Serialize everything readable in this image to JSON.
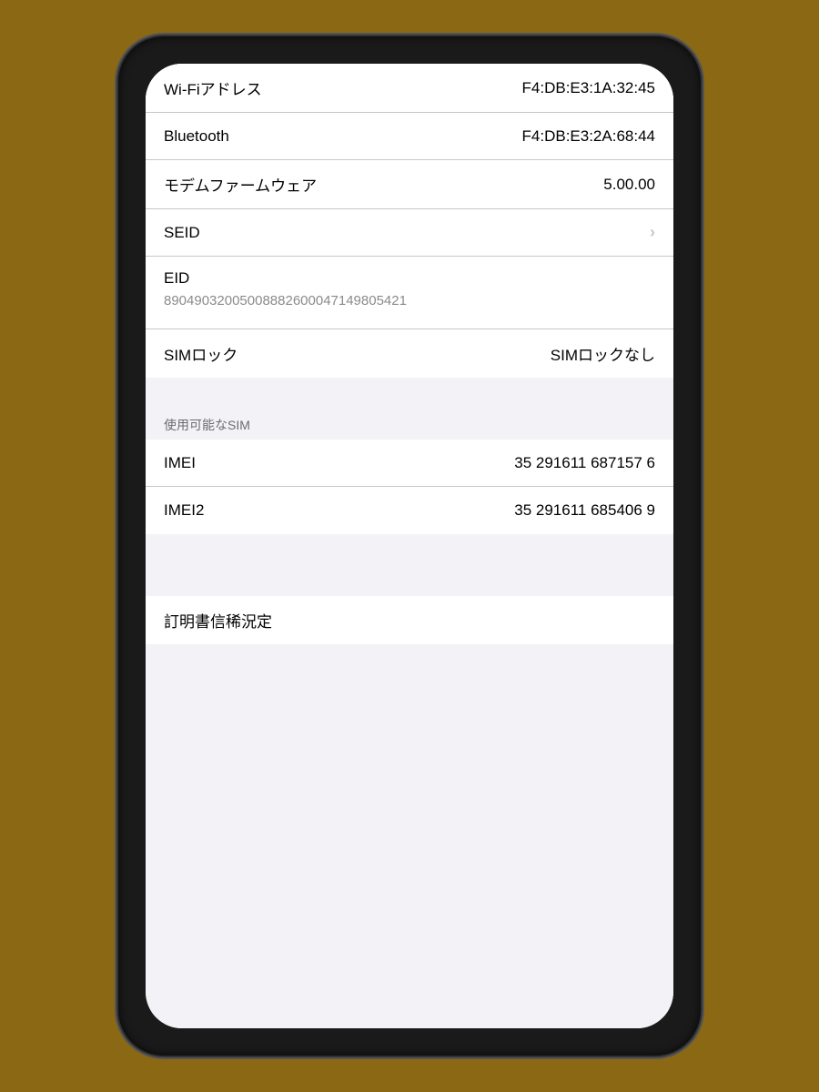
{
  "settings": {
    "rows": [
      {
        "id": "wifi-address",
        "label": "Wi-Fiアドレス",
        "value": "F4:DB:E3:1A:32:45",
        "has_chevron": false
      },
      {
        "id": "bluetooth",
        "label": "Bluetooth",
        "value": "F4:DB:E3:2A:68:44",
        "has_chevron": false
      },
      {
        "id": "modem-firmware",
        "label": "モデムファームウェア",
        "value": "5.00.00",
        "has_chevron": false
      },
      {
        "id": "seid",
        "label": "SEID",
        "value": "",
        "has_chevron": true
      }
    ],
    "eid": {
      "label": "EID",
      "value": "89049032005008882600047149805421"
    },
    "sim_lock": {
      "label": "SIMロック",
      "value": "SIMロックなし"
    },
    "section_sim": {
      "header": "使用可能なSIM"
    },
    "imei": {
      "label": "IMEI",
      "value": "35 291611 687157 6"
    },
    "imei2": {
      "label": "IMEI2",
      "value": "35 291611 685406 9"
    },
    "bottom_section": {
      "label": "訂明書信稀況定"
    }
  },
  "icons": {
    "chevron": "›"
  }
}
